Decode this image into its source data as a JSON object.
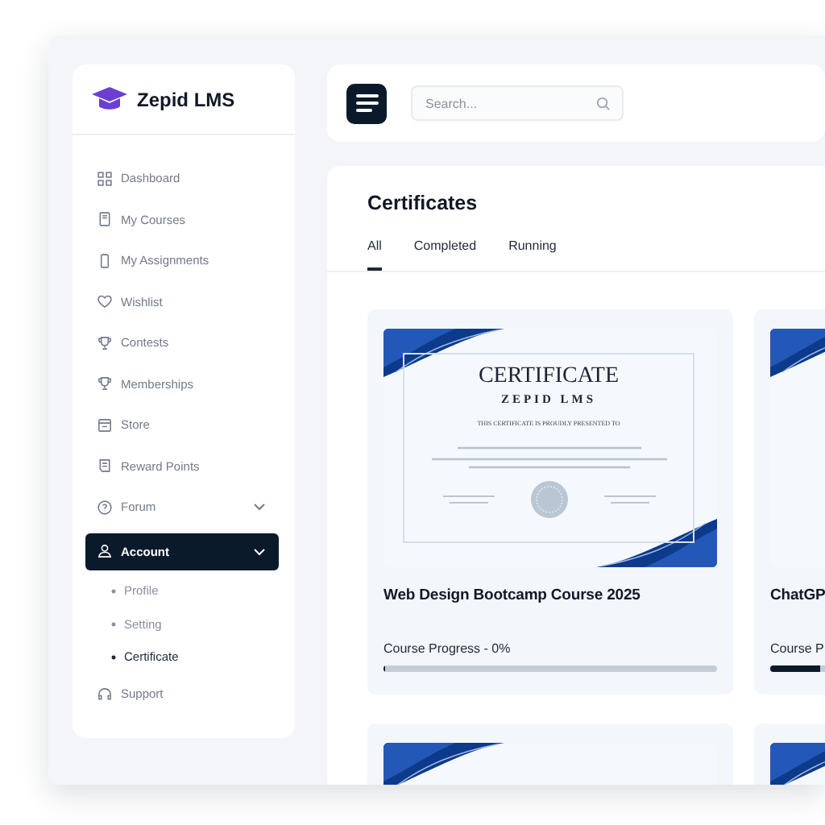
{
  "brand": {
    "name": "Zepid LMS"
  },
  "sidebar": {
    "items": [
      {
        "label": "Dashboard",
        "selected": false
      },
      {
        "label": "My Courses",
        "selected": false
      },
      {
        "label": "My Assignments",
        "selected": false
      },
      {
        "label": "Wishlist",
        "selected": false
      },
      {
        "label": "Contests",
        "selected": false
      },
      {
        "label": "Memberships",
        "selected": false
      },
      {
        "label": "Store",
        "selected": false
      },
      {
        "label": "Reward Points",
        "selected": false
      },
      {
        "label": "Forum",
        "selected": false,
        "kind": "group"
      },
      {
        "label": "Account",
        "selected": true,
        "kind": "group",
        "expanded": true,
        "children": [
          {
            "label": "Profile",
            "selected": false
          },
          {
            "label": "Setting",
            "selected": false
          },
          {
            "label": "Certificate",
            "selected": true
          }
        ]
      },
      {
        "label": "Support",
        "selected": false
      }
    ]
  },
  "search": {
    "placeholder": "Search..."
  },
  "page": {
    "title": "Certificates"
  },
  "tabs": [
    {
      "label": "All",
      "selected": true
    },
    {
      "label": "Completed",
      "selected": false
    },
    {
      "label": "Running",
      "selected": false
    }
  ],
  "cards": [
    {
      "kind": "course",
      "certificate": {
        "heading": "CERTIFICATE",
        "org": "ZEPID LMS",
        "subtitle": "THIS CERTIFICATE IS PROUDLY PRESENTED TO"
      },
      "title": "Web Design Bootcamp Course 2025",
      "progress_text": "Course Progress - 0%",
      "level": 0
    },
    {
      "kind": "course",
      "title": "ChatGP",
      "progress_text": "Course P",
      "level": 0.15
    },
    {
      "kind": "picture"
    },
    {
      "kind": "picture"
    }
  ]
}
